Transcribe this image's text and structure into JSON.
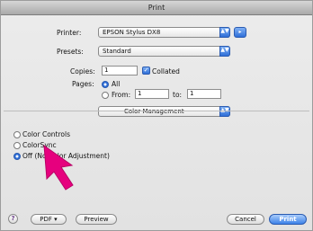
{
  "window": {
    "title": "Print"
  },
  "printer": {
    "label": "Printer:",
    "value": "EPSON Stylus DX8"
  },
  "presets": {
    "label": "Presets:",
    "value": "Standard"
  },
  "copies": {
    "label": "Copies:",
    "value": "1",
    "collated_label": "Collated",
    "collated": true
  },
  "pages": {
    "label": "Pages:",
    "all_label": "All",
    "from_label": "From:",
    "from_value": "1",
    "to_label": "to:",
    "to_value": "1",
    "selected": "All"
  },
  "panel": {
    "value": "Color Management"
  },
  "color_options": [
    {
      "label": "Color Controls",
      "selected": false
    },
    {
      "label": "ColorSync",
      "selected": false
    },
    {
      "label": "Off (No Color Adjustment)",
      "selected": true
    }
  ],
  "footer": {
    "help_label": "?",
    "pdf_label": "PDF ▾",
    "preview_label": "Preview",
    "cancel_label": "Cancel",
    "print_label": "Print"
  },
  "icons": {
    "popup_arrows": "▲▼",
    "check": "✓",
    "printer_extra": "▸"
  },
  "colors": {
    "accent": "#2f6fd8",
    "cursor": "#e6007e"
  }
}
